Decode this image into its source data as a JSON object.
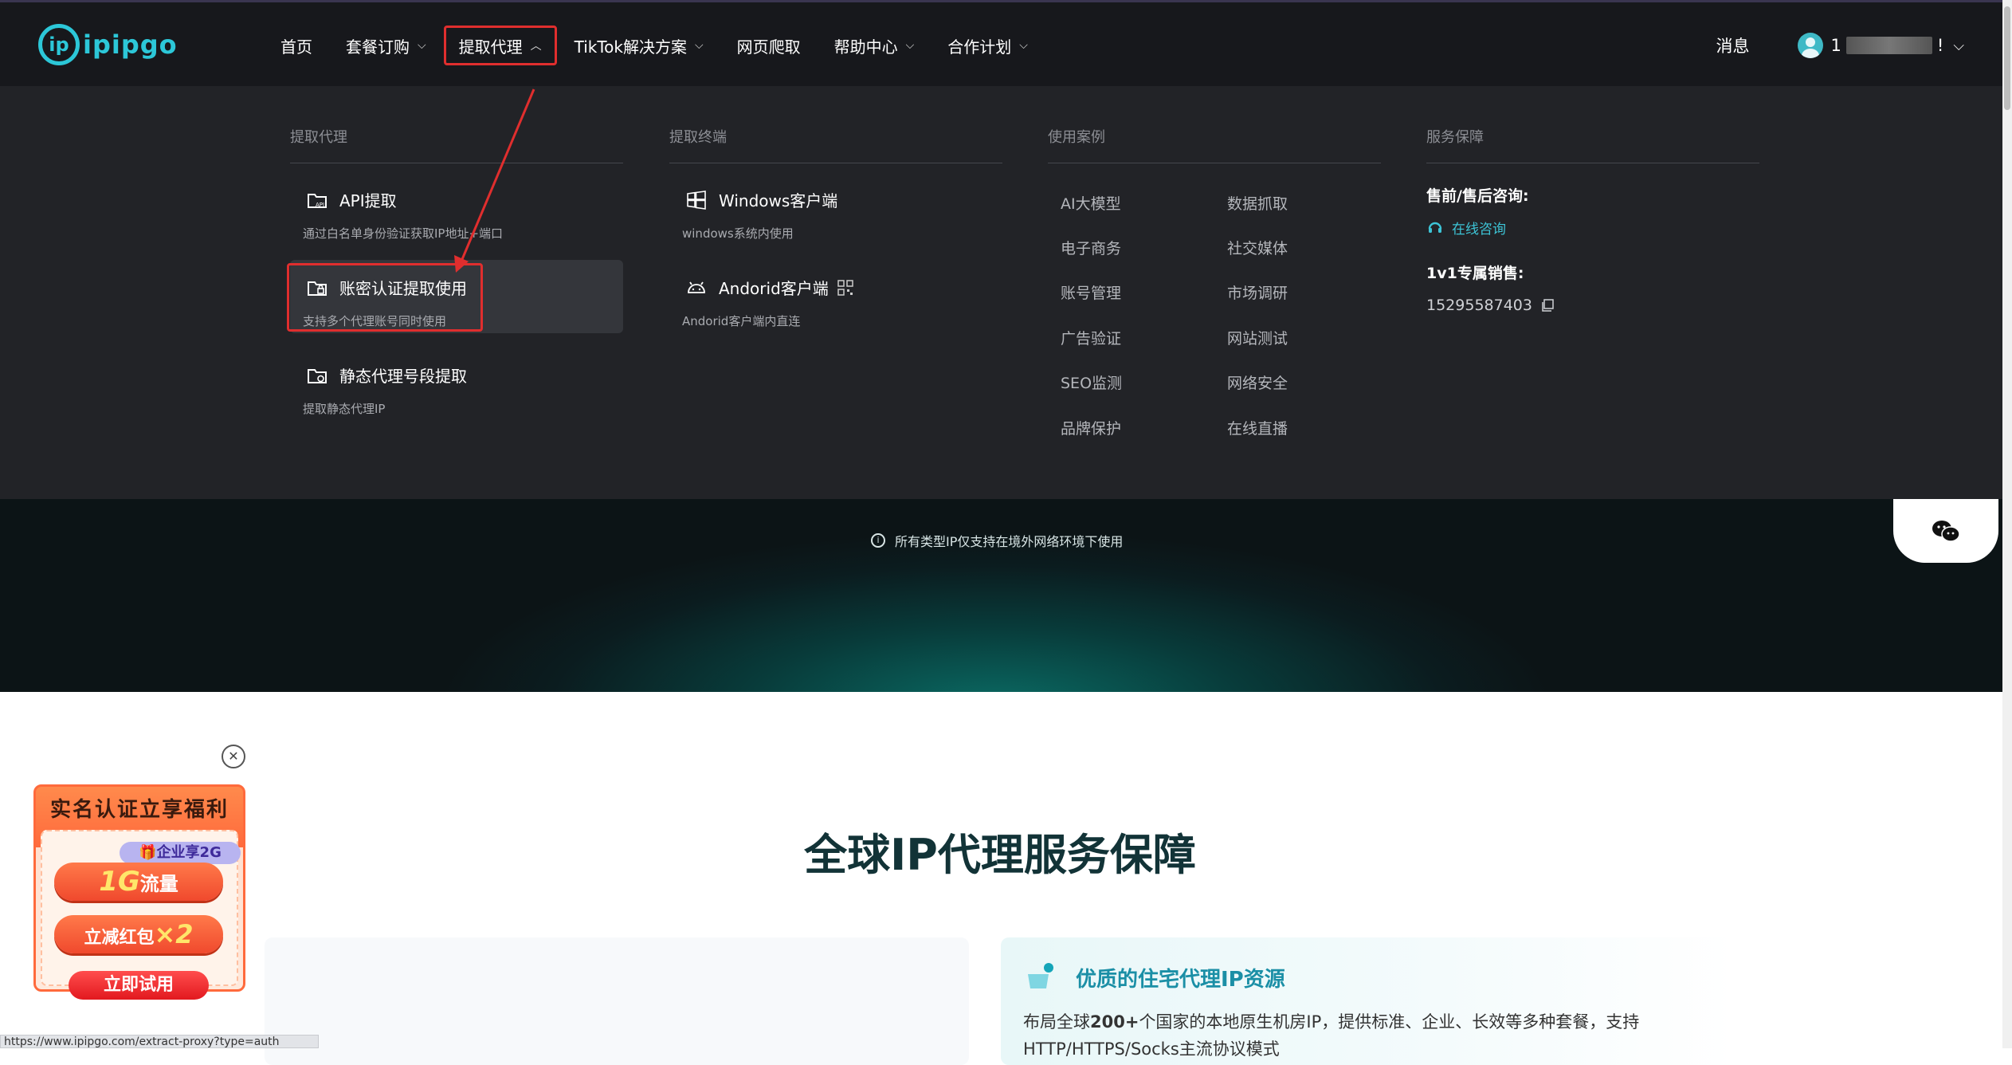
{
  "logo": {
    "text": "ipipgo"
  },
  "nav": {
    "items": [
      {
        "label": "首页"
      },
      {
        "label": "套餐订购"
      },
      {
        "label": "提取代理"
      },
      {
        "label": "TikTok解决方案"
      },
      {
        "label": "网页爬取"
      },
      {
        "label": "帮助中心"
      },
      {
        "label": "合作计划"
      }
    ],
    "messages": "消息",
    "user_prefix": "1",
    "user_suffix": "!"
  },
  "menu": {
    "col1": {
      "title": "提取代理",
      "items": [
        {
          "title": "API提取",
          "desc": "通过白名单身份验证获取IP地址+端口"
        },
        {
          "title": "账密认证提取使用",
          "desc": "支持多个代理账号同时使用"
        },
        {
          "title": "静态代理号段提取",
          "desc": "提取静态代理IP"
        }
      ]
    },
    "col2": {
      "title": "提取终端",
      "items": [
        {
          "title": "Windows客户端",
          "desc": "windows系统内使用"
        },
        {
          "title": "Andorid客户端",
          "desc": "Andorid客户端内直连"
        }
      ]
    },
    "col3": {
      "title": "使用案例",
      "items": [
        "AI大模型",
        "数据抓取",
        "电子商务",
        "社交媒体",
        "账号管理",
        "市场调研",
        "广告验证",
        "网站测试",
        "SEO监测",
        "网络安全",
        "品牌保护",
        "在线直播"
      ]
    },
    "col4": {
      "title": "服务保障",
      "presale_label": "售前/售后咨询:",
      "online_link": "在线咨询",
      "sales_label": "1v1专属销售:",
      "phone": "15295587403"
    }
  },
  "hero": {
    "note": "所有类型IP仅支持在境外网络环境下使用"
  },
  "main": {
    "title": "全球IP代理服务保障",
    "feature_title": "优质的住宅代理IP资源",
    "feature_desc_a": "布局全球",
    "feature_desc_b": "200+",
    "feature_desc_c": "个国家的本地原生机房IP，提供标准、企业、长效等多种套餐，支持",
    "feature_desc_line2": "HTTP/HTTPS/Socks主流协议模式"
  },
  "promo": {
    "headline": "实名认证立享福利",
    "tag": "企业享2G",
    "traffic_big": "1G",
    "traffic_unit": "流量",
    "coupon_text": "立减红包",
    "coupon_mult": "×2",
    "cta": "立即试用"
  },
  "status_url": "https://www.ipipgo.com/extract-proxy?type=auth",
  "colors": {
    "accent": "#2cc7d8",
    "highlight_red": "#e02e2e",
    "menu_bg": "#222327",
    "nav_bg": "#17181c"
  }
}
